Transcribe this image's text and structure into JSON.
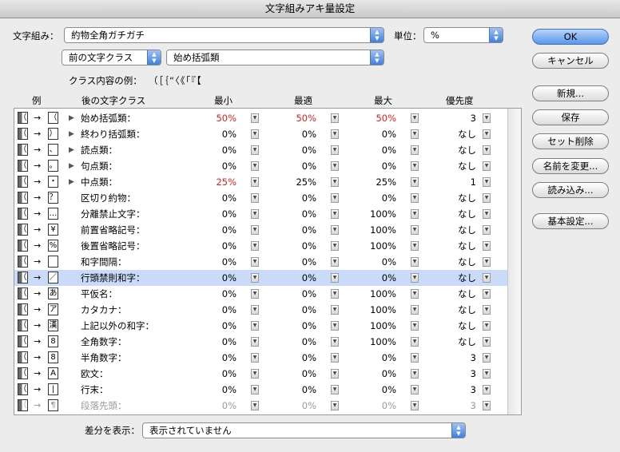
{
  "window": {
    "title": "文字組みアキ量設定"
  },
  "top": {
    "mojigumi_label": "文字組み：",
    "mojigumi_value": "約物全角ガチガチ",
    "unit_label": "単位：",
    "unit_value": "%",
    "prev_class_value": "前の文字クラス",
    "class_value": "始め括弧類",
    "example_label": "クラス内容の例：",
    "example_chars": "（［｛“〈《「『【"
  },
  "buttons": {
    "ok": "OK",
    "cancel": "キャンセル",
    "new": "新規...",
    "save": "保存",
    "delete": "セット削除",
    "rename": "名前を変更...",
    "load": "読み込み...",
    "basic": "基本設定..."
  },
  "table": {
    "headers": {
      "example": "例",
      "next_class": "後の文字クラス",
      "min": "最小",
      "opt": "最適",
      "max": "最大",
      "priority": "優先度"
    },
    "rows": [
      {
        "glyph": "（",
        "name": "始め括弧類：",
        "min": "50%",
        "opt": "50%",
        "max": "50%",
        "pri": "3",
        "tri": true,
        "red": [
          1,
          1,
          1
        ]
      },
      {
        "glyph": "）",
        "name": "終わり括弧類：",
        "min": "0%",
        "opt": "0%",
        "max": "0%",
        "pri": "なし",
        "tri": true,
        "red": [
          0,
          0,
          0
        ]
      },
      {
        "glyph": "、",
        "name": "読点類：",
        "min": "0%",
        "opt": "0%",
        "max": "0%",
        "pri": "なし",
        "tri": true,
        "red": [
          0,
          0,
          0
        ]
      },
      {
        "glyph": "。",
        "name": "句点類：",
        "min": "0%",
        "opt": "0%",
        "max": "0%",
        "pri": "なし",
        "tri": true,
        "red": [
          0,
          0,
          0
        ]
      },
      {
        "glyph": "・",
        "name": "中点類：",
        "min": "25%",
        "opt": "25%",
        "max": "25%",
        "pri": "1",
        "tri": true,
        "red": [
          1,
          0,
          0
        ]
      },
      {
        "glyph": "？",
        "name": "区切り約物：",
        "min": "0%",
        "opt": "0%",
        "max": "0%",
        "pri": "なし",
        "tri": false,
        "red": [
          0,
          0,
          0
        ]
      },
      {
        "glyph": "…",
        "name": "分離禁止文字：",
        "min": "0%",
        "opt": "0%",
        "max": "100%",
        "pri": "なし",
        "tri": false,
        "red": [
          0,
          0,
          0
        ]
      },
      {
        "glyph": "¥",
        "name": "前置省略記号：",
        "min": "0%",
        "opt": "0%",
        "max": "100%",
        "pri": "なし",
        "tri": false,
        "red": [
          0,
          0,
          0
        ]
      },
      {
        "glyph": "%",
        "name": "後置省略記号：",
        "min": "0%",
        "opt": "0%",
        "max": "100%",
        "pri": "なし",
        "tri": false,
        "red": [
          0,
          0,
          0
        ]
      },
      {
        "glyph": " ",
        "name": "和字間隔：",
        "min": "0%",
        "opt": "0%",
        "max": "0%",
        "pri": "なし",
        "tri": false,
        "red": [
          0,
          0,
          0
        ]
      },
      {
        "glyph": "／",
        "name": "行頭禁則和字：",
        "min": "0%",
        "opt": "0%",
        "max": "0%",
        "pri": "なし",
        "tri": false,
        "red": [
          0,
          0,
          0
        ],
        "sel": true
      },
      {
        "glyph": "あ",
        "name": "平仮名：",
        "min": "0%",
        "opt": "0%",
        "max": "100%",
        "pri": "なし",
        "tri": false,
        "red": [
          0,
          0,
          0
        ]
      },
      {
        "glyph": "ア",
        "name": "カタカナ：",
        "min": "0%",
        "opt": "0%",
        "max": "100%",
        "pri": "なし",
        "tri": false,
        "red": [
          0,
          0,
          0
        ]
      },
      {
        "glyph": "漢",
        "name": "上記以外の和字：",
        "min": "0%",
        "opt": "0%",
        "max": "100%",
        "pri": "なし",
        "tri": false,
        "red": [
          0,
          0,
          0
        ]
      },
      {
        "glyph": "8",
        "name": "全角数字：",
        "min": "0%",
        "opt": "0%",
        "max": "100%",
        "pri": "なし",
        "tri": false,
        "red": [
          0,
          0,
          0
        ]
      },
      {
        "glyph": "8",
        "name": "半角数字：",
        "min": "0%",
        "opt": "0%",
        "max": "0%",
        "pri": "3",
        "tri": false,
        "red": [
          0,
          0,
          0
        ]
      },
      {
        "glyph": "A",
        "name": "欧文：",
        "min": "0%",
        "opt": "0%",
        "max": "0%",
        "pri": "3",
        "tri": false,
        "red": [
          0,
          0,
          0
        ]
      },
      {
        "glyph": "|",
        "name": "行末：",
        "min": "0%",
        "opt": "0%",
        "max": "0%",
        "pri": "3",
        "tri": false,
        "red": [
          0,
          0,
          0
        ]
      },
      {
        "glyph": "¶",
        "name": "段落先頭：",
        "min": "0%",
        "opt": "0%",
        "max": "0%",
        "pri": "3",
        "tri": false,
        "red": [
          0,
          0,
          0
        ],
        "dim": true
      }
    ]
  },
  "bottom": {
    "diff_label": "差分を表示：",
    "diff_value": "表示されていません"
  },
  "colors": {
    "accent": "#3f7fe0",
    "selection": "#c9dbf8",
    "highlight": "#e02020"
  },
  "icons": {
    "arrow": "right-arrow-icon",
    "stepper": "stepper-icon",
    "disclosure": "disclosure-triangle-icon"
  }
}
